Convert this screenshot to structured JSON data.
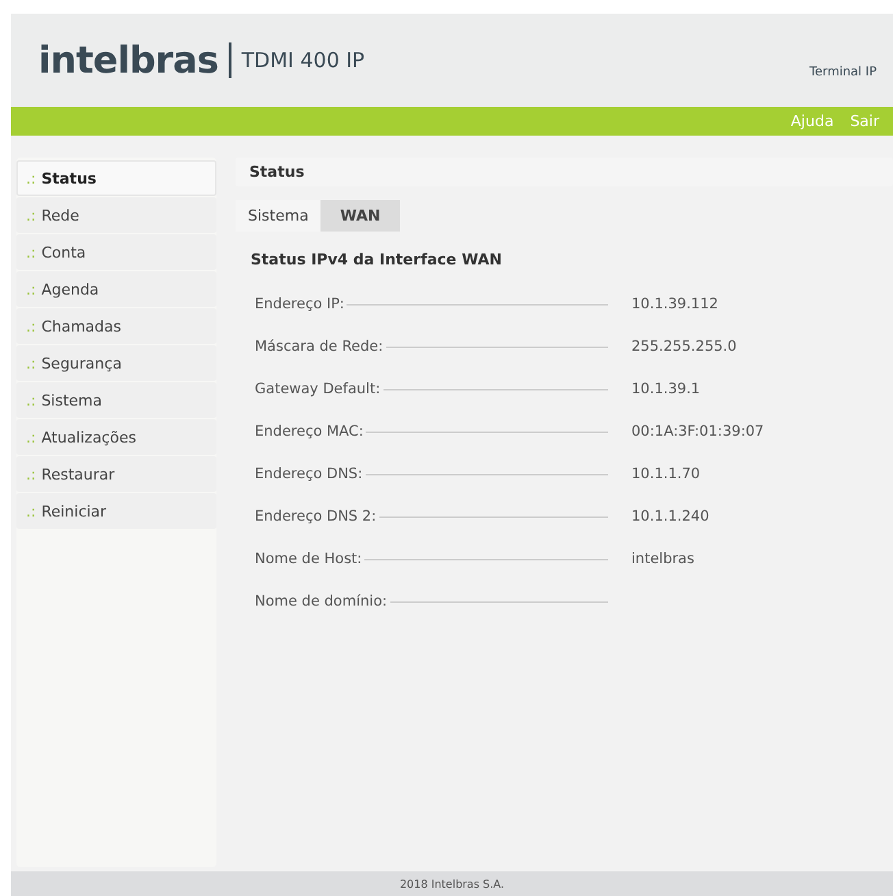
{
  "header": {
    "logo": "intelbras",
    "product": "TDMI 400 IP",
    "device_type": "Terminal IP"
  },
  "top_links": [
    "Ajuda",
    "Sair"
  ],
  "sidebar": {
    "items": [
      {
        "marker": ".:",
        "label": "Status",
        "selected": true
      },
      {
        "marker": ".:",
        "label": "Rede",
        "selected": false
      },
      {
        "marker": ".:",
        "label": "Conta",
        "selected": false
      },
      {
        "marker": ".:",
        "label": "Agenda",
        "selected": false
      },
      {
        "marker": ".:",
        "label": "Chamadas",
        "selected": false
      },
      {
        "marker": ".:",
        "label": "Segurança",
        "selected": false
      },
      {
        "marker": ".:",
        "label": "Sistema",
        "selected": false
      },
      {
        "marker": ".:",
        "label": "Atualizações",
        "selected": false
      },
      {
        "marker": ".:",
        "label": "Restaurar",
        "selected": false
      },
      {
        "marker": ".:",
        "label": "Reiniciar",
        "selected": false
      }
    ]
  },
  "panel": {
    "title": "Status",
    "tabs": [
      {
        "label": "Sistema",
        "selected": false
      },
      {
        "label": "WAN",
        "selected": true
      }
    ],
    "section_title": "Status IPv4 da Interface WAN",
    "fields": [
      {
        "label": "Endereço IP:",
        "value": "10.1.39.112"
      },
      {
        "label": "Máscara de Rede:",
        "value": "255.255.255.0"
      },
      {
        "label": "Gateway Default:",
        "value": "10.1.39.1"
      },
      {
        "label": "Endereço MAC:",
        "value": "00:1A:3F:01:39:07"
      },
      {
        "label": "Endereço DNS:",
        "value": "10.1.1.70"
      },
      {
        "label": "Endereço DNS 2:",
        "value": "10.1.1.240"
      },
      {
        "label": "Nome de Host:",
        "value": "intelbras"
      },
      {
        "label": "Nome de domínio:"
      }
    ]
  },
  "footer": "2018 Intelbras S.A."
}
